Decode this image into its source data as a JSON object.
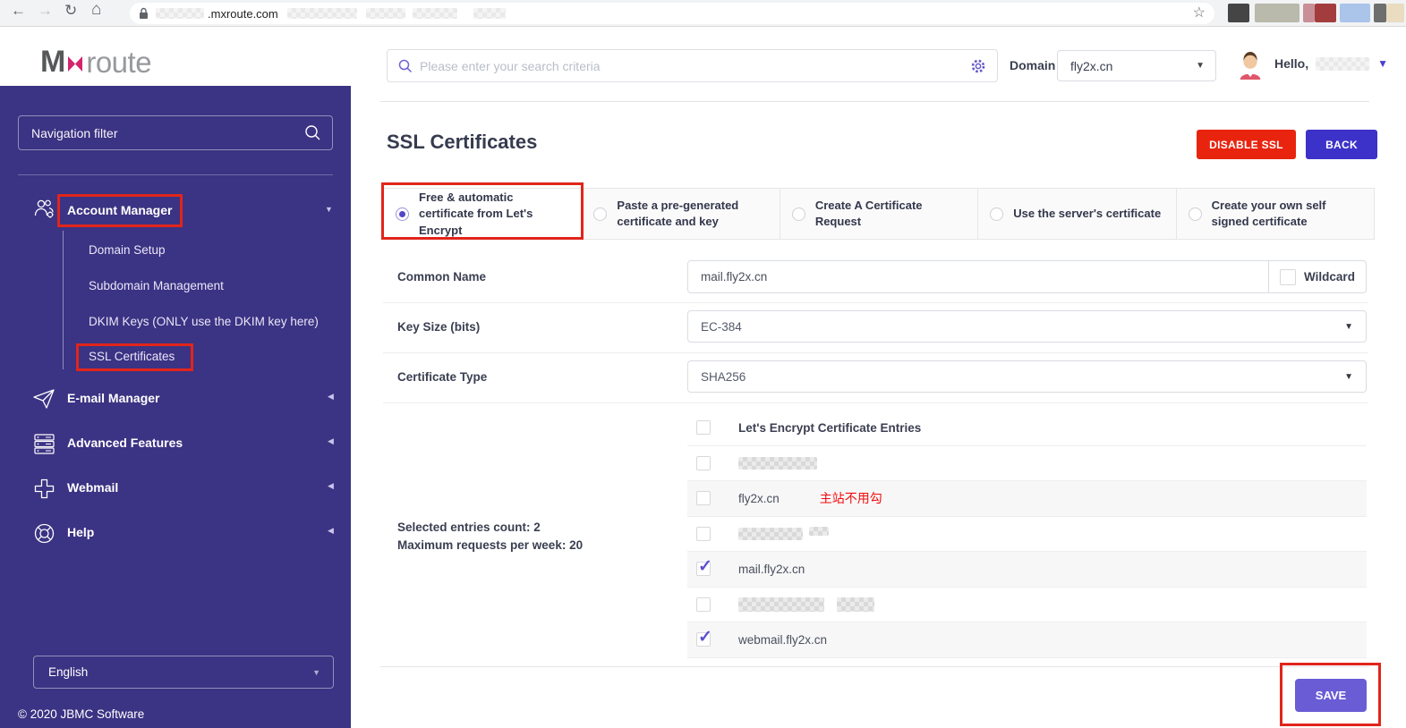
{
  "browser": {
    "url_visible": ".mxroute.com",
    "back_icon": "←",
    "forward_icon": "→",
    "refresh_icon": "↻",
    "home_icon": "⌂",
    "star_icon": "☆"
  },
  "brand": {
    "m": "M",
    "rest": "route"
  },
  "sidebar": {
    "filter_placeholder": "Navigation filter",
    "account_manager": "Account Manager",
    "submenu": [
      "Domain Setup",
      "Subdomain Management",
      "DKIM Keys (ONLY use the DKIM key here)",
      "SSL Certificates"
    ],
    "items": [
      "E-mail Manager",
      "Advanced Features",
      "Webmail",
      "Help"
    ],
    "language": "English",
    "copyright": "© 2020 JBMC Software"
  },
  "topbar": {
    "search_placeholder": "Please enter your search criteria",
    "domain_label": "Domain",
    "domain_value": "fly2x.cn",
    "greeting": "Hello,"
  },
  "page": {
    "title": "SSL Certificates",
    "disable_ssl": "DISABLE SSL",
    "back": "BACK",
    "save": "SAVE"
  },
  "tabs": [
    {
      "label": "Free & automatic certificate from Let's Encrypt",
      "selected": true
    },
    {
      "label": "Paste a pre-generated certificate and key",
      "selected": false
    },
    {
      "label": "Create A Certificate Request",
      "selected": false
    },
    {
      "label": "Use the server's certificate",
      "selected": false
    },
    {
      "label": "Create your own self signed certificate",
      "selected": false
    }
  ],
  "form": {
    "common_name_label": "Common Name",
    "common_name_value": "mail.fly2x.cn",
    "wildcard_label": "Wildcard",
    "key_size_label": "Key Size (bits)",
    "key_size_value": "EC-384",
    "certificate_type_label": "Certificate Type",
    "certificate_type_value": "SHA256",
    "selected_count": "Selected entries count: 2",
    "max_requests": "Maximum requests per week: 20"
  },
  "entries": {
    "header": "Let's Encrypt Certificate Entries",
    "rows": [
      {
        "label": "",
        "redacted": true,
        "checked": false
      },
      {
        "label": "fly2x.cn",
        "redacted": false,
        "checked": false,
        "note": "主站不用勾"
      },
      {
        "label": "",
        "redacted": true,
        "checked": false
      },
      {
        "label": "mail.fly2x.cn",
        "redacted": false,
        "checked": true
      },
      {
        "label": "",
        "redacted": true,
        "checked": false
      },
      {
        "label": "webmail.fly2x.cn",
        "redacted": false,
        "checked": true
      }
    ]
  },
  "colors": {
    "sidebar_bg": "#3b3383",
    "annotation_red": "#e1251b",
    "brand_magenta": "#d3246c",
    "disable_ssl_bg": "#e8240f",
    "back_bg": "#3c31c8",
    "save_bg": "#695cd5",
    "note_red": "#f20d0d"
  }
}
